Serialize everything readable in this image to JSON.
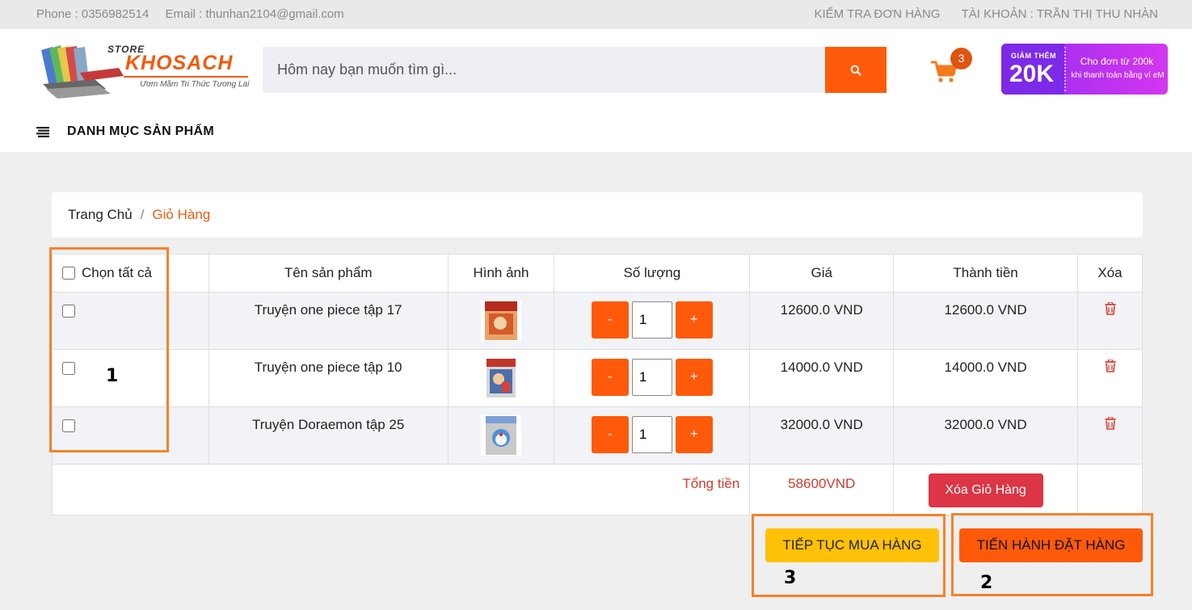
{
  "topbar": {
    "phone": "Phone : 0356982514",
    "email": "Email : thunhan2104@gmail.com",
    "check_order": "KIỂM TRA ĐƠN HÀNG",
    "account": "TÀI KHOẢN : TRẦN THỊ THU NHÀN"
  },
  "logo": {
    "store": "STORE",
    "name": "KHOSACH",
    "slogan": "Ươm Mầm Tri Thức Tương Lai"
  },
  "search": {
    "placeholder": "Hôm nay bạn muốn tìm gì...",
    "icon": "search-icon"
  },
  "cart": {
    "count": "3",
    "icon": "cart-icon"
  },
  "promo": {
    "line1": "GIẢM THÊM",
    "amount": "20K",
    "line2": "Cho đơn từ 200k",
    "line3": "khi thanh toán bằng ví eM"
  },
  "category_nav": {
    "label": "DANH MỤC SẢN PHẨM",
    "icon": "menu-icon"
  },
  "breadcrumb": {
    "home": "Trang Chủ",
    "separator": "/",
    "current": "Giỏ Hàng"
  },
  "table": {
    "headers": {
      "select_all": "Chọn tất cả",
      "name": "Tên sản phẩm",
      "image": "Hình ảnh",
      "quantity": "Số lượng",
      "price": "Giá",
      "subtotal": "Thành tiền",
      "delete": "Xóa"
    },
    "rows": [
      {
        "name": "Truyện one piece tập 17",
        "qty": "1",
        "price": "12600.0 VND",
        "subtotal": "12600.0 VND",
        "minus": "-",
        "plus": "+"
      },
      {
        "name": "Truyện one piece tập 10",
        "qty": "1",
        "price": "14000.0 VND",
        "subtotal": "14000.0 VND",
        "minus": "-",
        "plus": "+"
      },
      {
        "name": "Truyện Doraemon tập 25",
        "qty": "1",
        "price": "32000.0 VND",
        "subtotal": "32000.0 VND",
        "minus": "-",
        "plus": "+"
      }
    ],
    "total_label": "Tổng tiền",
    "total_value": "58600VND",
    "clear_cart": "Xóa Giỏ Hàng"
  },
  "actions": {
    "continue_shopping": "TIẾP TỤC MUA HÀNG",
    "place_order": "TIẾN HÀNH ĐẶT HÀNG"
  },
  "annotations": [
    "1",
    "2",
    "3"
  ],
  "colors": {
    "accent": "#ff5a0a",
    "danger": "#dc3545",
    "warning": "#ffc107",
    "annotation": "#f5822a"
  }
}
